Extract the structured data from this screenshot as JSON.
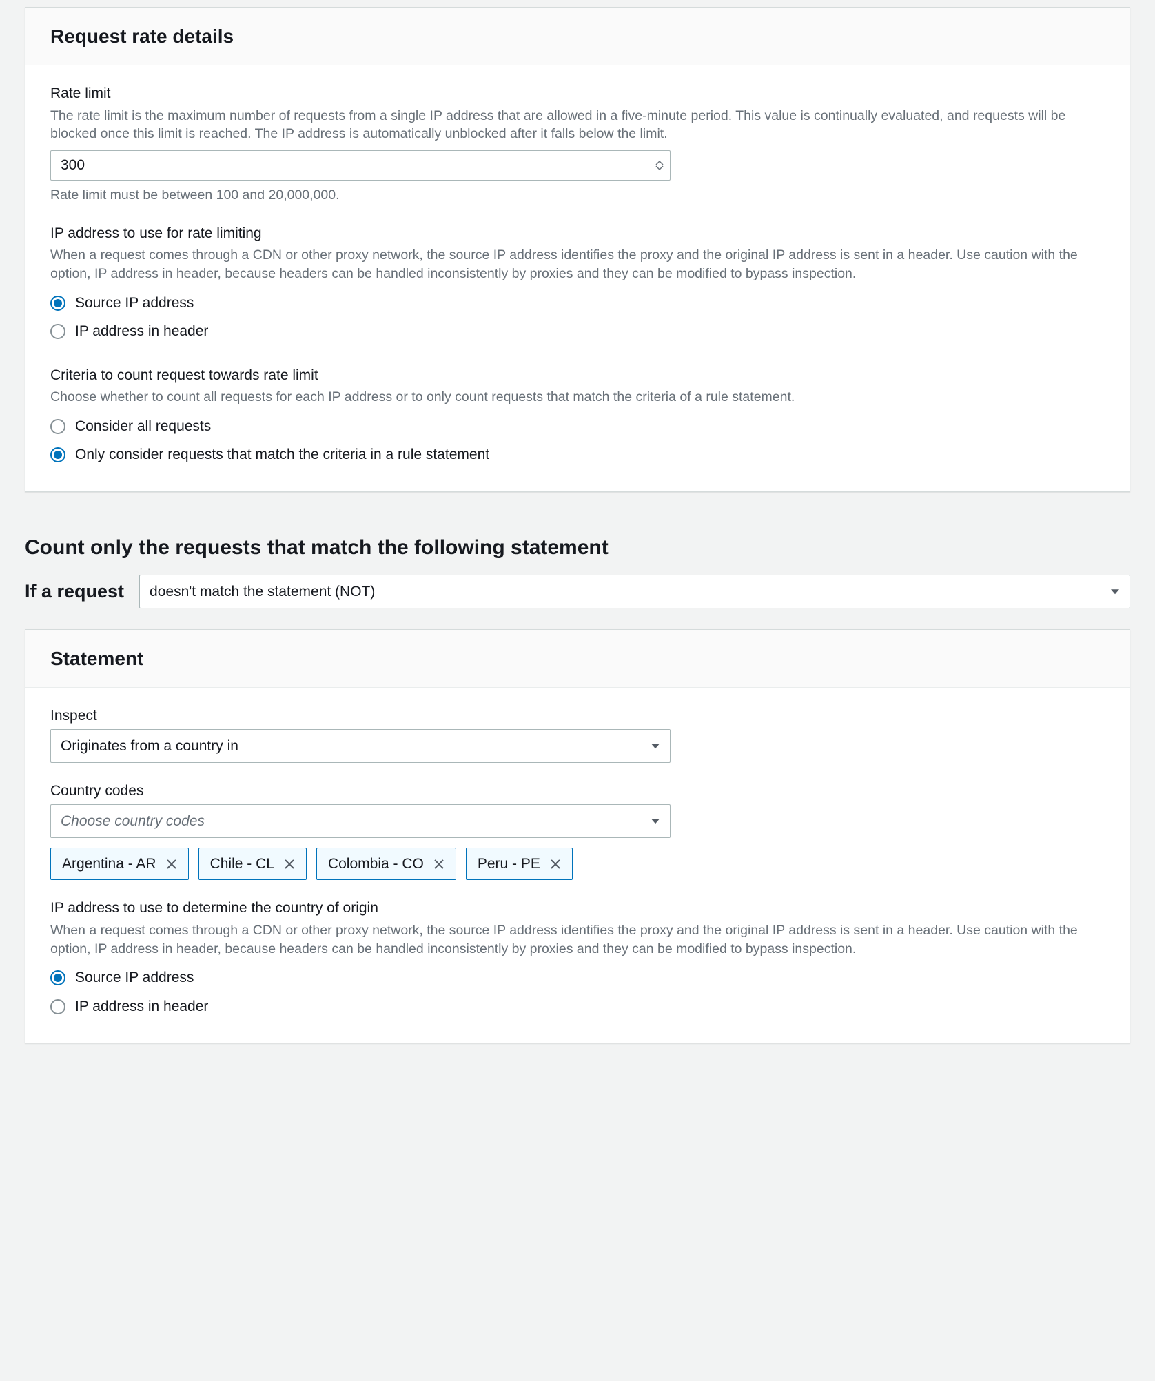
{
  "rateDetails": {
    "title": "Request rate details",
    "rateLimit": {
      "label": "Rate limit",
      "desc": "The rate limit is the maximum number of requests from a single IP address that are allowed in a five-minute period. This value is continually evaluated, and requests will be blocked once this limit is reached. The IP address is automatically unblocked after it falls below the limit.",
      "value": "300",
      "help": "Rate limit must be between 100 and 20,000,000."
    },
    "ipToUse": {
      "label": "IP address to use for rate limiting",
      "desc": "When a request comes through a CDN or other proxy network, the source IP address identifies the proxy and the original IP address is sent in a header. Use caution with the option, IP address in header, because headers can be handled inconsistently by proxies and they can be modified to bypass inspection.",
      "options": {
        "source": "Source IP address",
        "header": "IP address in header"
      },
      "selected": "source"
    },
    "criteria": {
      "label": "Criteria to count request towards rate limit",
      "desc": "Choose whether to count all requests for each IP address or to only count requests that match the criteria of a rule statement.",
      "options": {
        "all": "Consider all requests",
        "match": "Only consider requests that match the criteria in a rule statement"
      },
      "selected": "match"
    }
  },
  "countHeading": "Count only the requests that match the following statement",
  "ifRequest": {
    "label": "If a request",
    "selected": "doesn't match the statement (NOT)"
  },
  "statement": {
    "title": "Statement",
    "inspect": {
      "label": "Inspect",
      "selected": "Originates from a country in"
    },
    "countryCodes": {
      "label": "Country codes",
      "placeholder": "Choose country codes",
      "tags": [
        {
          "label": "Argentina - AR"
        },
        {
          "label": "Chile - CL"
        },
        {
          "label": "Colombia - CO"
        },
        {
          "label": "Peru - PE"
        }
      ]
    },
    "originIp": {
      "label": "IP address to use to determine the country of origin",
      "desc": "When a request comes through a CDN or other proxy network, the source IP address identifies the proxy and the original IP address is sent in a header. Use caution with the option, IP address in header, because headers can be handled inconsistently by proxies and they can be modified to bypass inspection.",
      "options": {
        "source": "Source IP address",
        "header": "IP address in header"
      },
      "selected": "source"
    }
  }
}
